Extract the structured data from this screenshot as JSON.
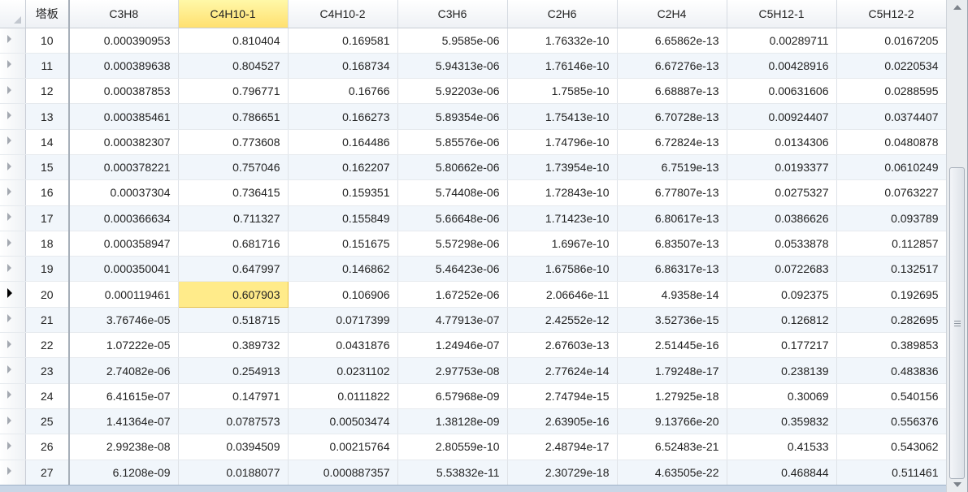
{
  "columns": [
    "塔板",
    "C3H8",
    "C4H10-1",
    "C4H10-2",
    "C3H6",
    "C2H6",
    "C2H4",
    "C5H12-1",
    "C5H12-2"
  ],
  "selected_column": "C4H10-1",
  "current_row_plate": "20",
  "rows": [
    [
      "10",
      "0.000390953",
      "0.810404",
      "0.169581",
      "5.9585e-06",
      "1.76332e-10",
      "6.65862e-13",
      "0.00289711",
      "0.0167205"
    ],
    [
      "11",
      "0.000389638",
      "0.804527",
      "0.168734",
      "5.94313e-06",
      "1.76146e-10",
      "6.67276e-13",
      "0.00428916",
      "0.0220534"
    ],
    [
      "12",
      "0.000387853",
      "0.796771",
      "0.16766",
      "5.92203e-06",
      "1.7585e-10",
      "6.68887e-13",
      "0.00631606",
      "0.0288595"
    ],
    [
      "13",
      "0.000385461",
      "0.786651",
      "0.166273",
      "5.89354e-06",
      "1.75413e-10",
      "6.70728e-13",
      "0.00924407",
      "0.0374407"
    ],
    [
      "14",
      "0.000382307",
      "0.773608",
      "0.164486",
      "5.85576e-06",
      "1.74796e-10",
      "6.72824e-13",
      "0.0134306",
      "0.0480878"
    ],
    [
      "15",
      "0.000378221",
      "0.757046",
      "0.162207",
      "5.80662e-06",
      "1.73954e-10",
      "6.7519e-13",
      "0.0193377",
      "0.0610249"
    ],
    [
      "16",
      "0.00037304",
      "0.736415",
      "0.159351",
      "5.74408e-06",
      "1.72843e-10",
      "6.77807e-13",
      "0.0275327",
      "0.0763227"
    ],
    [
      "17",
      "0.000366634",
      "0.711327",
      "0.155849",
      "5.66648e-06",
      "1.71423e-10",
      "6.80617e-13",
      "0.0386626",
      "0.093789"
    ],
    [
      "18",
      "0.000358947",
      "0.681716",
      "0.151675",
      "5.57298e-06",
      "1.6967e-10",
      "6.83507e-13",
      "0.0533878",
      "0.112857"
    ],
    [
      "19",
      "0.000350041",
      "0.647997",
      "0.146862",
      "5.46423e-06",
      "1.67586e-10",
      "6.86317e-13",
      "0.0722683",
      "0.132517"
    ],
    [
      "20",
      "0.000119461",
      "0.607903",
      "0.106906",
      "1.67252e-06",
      "2.06646e-11",
      "4.9358e-14",
      "0.092375",
      "0.192695"
    ],
    [
      "21",
      "3.76746e-05",
      "0.518715",
      "0.0717399",
      "4.77913e-07",
      "2.42552e-12",
      "3.52736e-15",
      "0.126812",
      "0.282695"
    ],
    [
      "22",
      "1.07222e-05",
      "0.389732",
      "0.0431876",
      "1.24946e-07",
      "2.67603e-13",
      "2.51445e-16",
      "0.177217",
      "0.389853"
    ],
    [
      "23",
      "2.74082e-06",
      "0.254913",
      "0.0231102",
      "2.97753e-08",
      "2.77624e-14",
      "1.79248e-17",
      "0.238139",
      "0.483836"
    ],
    [
      "24",
      "6.41615e-07",
      "0.147971",
      "0.0111822",
      "6.57968e-09",
      "2.74794e-15",
      "1.27925e-18",
      "0.30069",
      "0.540156"
    ],
    [
      "25",
      "1.41364e-07",
      "0.0787573",
      "0.00503474",
      "1.38128e-09",
      "2.63905e-16",
      "9.13766e-20",
      "0.359832",
      "0.556376"
    ],
    [
      "26",
      "2.99238e-08",
      "0.0394509",
      "0.00215764",
      "2.80559e-10",
      "2.48794e-17",
      "6.52483e-21",
      "0.41533",
      "0.543062"
    ],
    [
      "27",
      "6.1208e-09",
      "0.0188077",
      "0.000887357",
      "5.53832e-11",
      "2.30729e-18",
      "4.63505e-22",
      "0.468844",
      "0.511461"
    ]
  ],
  "colors": {
    "selection_fill": "#ffeb8a",
    "header_selected": "#ffe070",
    "alt_row": "#f1f6fb"
  },
  "icons": {
    "row_indicator": "triangle-right-icon",
    "corner": "select-all-triangle-icon",
    "scroll_grip": "grip-lines-icon"
  }
}
